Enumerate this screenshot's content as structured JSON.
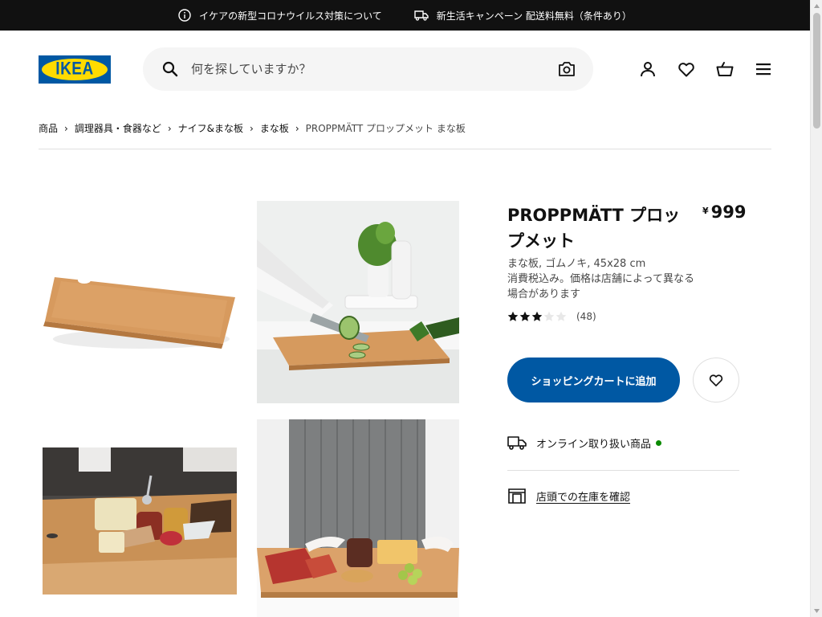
{
  "topbar": {
    "covid_text": "イケアの新型コロナウイルス対策について",
    "campaign_text": "新生活キャンペーン 配送料無料（条件あり）",
    "icons": [
      "info-icon",
      "truck-icon"
    ]
  },
  "header": {
    "logo_text": "IKEA",
    "search_placeholder": "何を探していますか？",
    "icons": [
      "search-icon",
      "camera-icon",
      "user-icon",
      "heart-icon",
      "basket-icon",
      "menu-icon"
    ]
  },
  "breadcrumb": {
    "items": [
      "商品",
      "調理器具・食器など",
      "ナイフ&まな板",
      "まな板"
    ],
    "current": "PROPPMÄTT プロップメット まな板"
  },
  "product": {
    "name": "PROPPMÄTT プロップメット",
    "currency": "¥",
    "price": "999",
    "desc_line1": "まな板, ゴムノキ, 45x28 cm",
    "desc_line2": "消費税込み。価格は店舗によって異なる場合があります",
    "rating": 3,
    "rating_max": 5,
    "review_count": "(48)",
    "add_to_cart": "ショッピングカートに追加",
    "online_label": "オンライン取り扱い商品",
    "stock_label": "店頭での在庫を確認"
  },
  "colors": {
    "ikea_blue": "#0058a3",
    "ikea_yellow": "#ffdb00",
    "available_green": "#0a8a00",
    "topbar_bg": "#111111"
  }
}
